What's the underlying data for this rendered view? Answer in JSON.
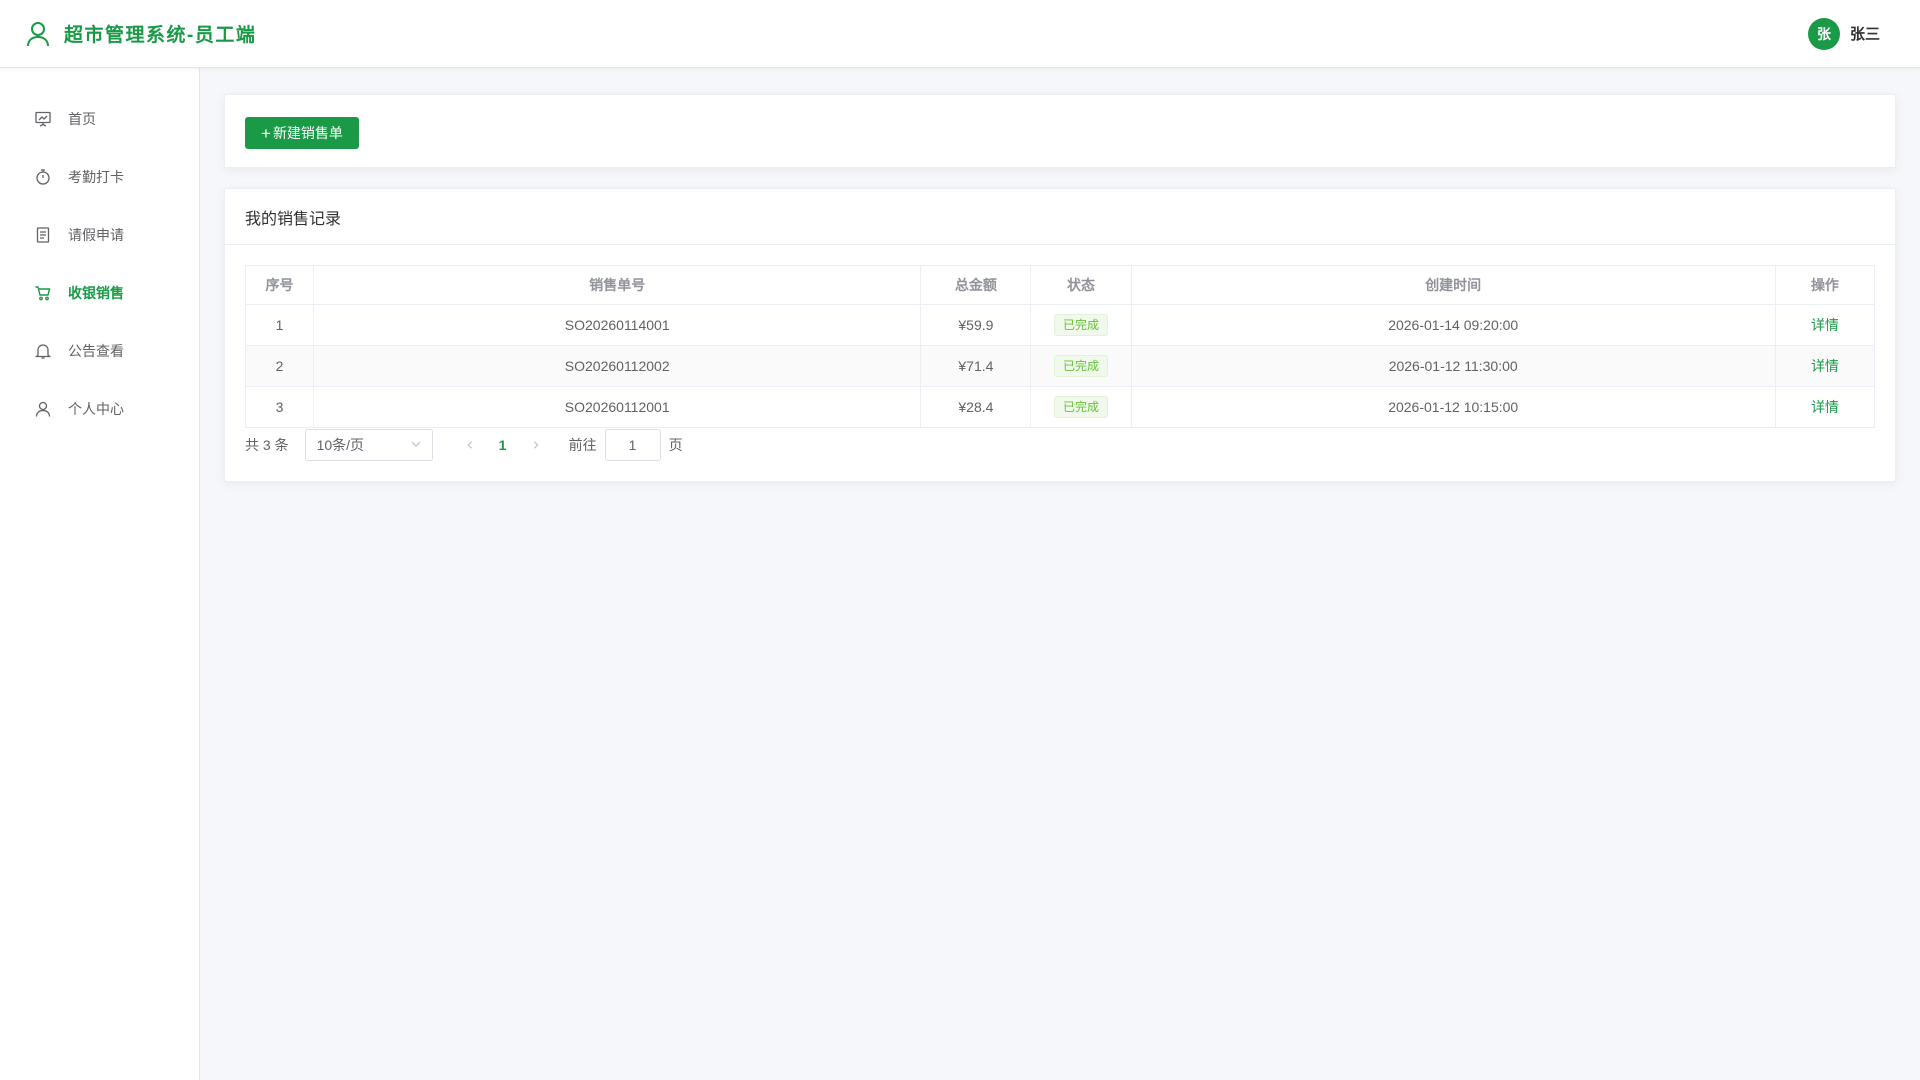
{
  "header": {
    "title": "超市管理系统-员工端",
    "avatar_text": "张",
    "username": "张三",
    "brand_icon": "user-outline-icon",
    "accent_color": "#1a9a46"
  },
  "sidebar": {
    "items": [
      {
        "label": "首页",
        "icon": "dashboard-board-icon",
        "active": false
      },
      {
        "label": "考勤打卡",
        "icon": "stopwatch-icon",
        "active": false
      },
      {
        "label": "请假申请",
        "icon": "document-icon",
        "active": false
      },
      {
        "label": "收银销售",
        "icon": "shopping-cart-icon",
        "active": true
      },
      {
        "label": "公告查看",
        "icon": "bell-icon",
        "active": false
      },
      {
        "label": "个人中心",
        "icon": "user-icon",
        "active": false
      }
    ]
  },
  "toolbar": {
    "new_sale_plus": "+",
    "new_sale_label": "新建销售单"
  },
  "records": {
    "title": "我的销售记录",
    "columns": [
      "序号",
      "销售单号",
      "总金额",
      "状态",
      "创建时间",
      "操作"
    ],
    "rows": [
      {
        "index": "1",
        "order_no": "SO20260114001",
        "amount": "¥59.9",
        "status": "已完成",
        "created": "2026-01-14 09:20:00",
        "action": "详情"
      },
      {
        "index": "2",
        "order_no": "SO20260112002",
        "amount": "¥71.4",
        "status": "已完成",
        "created": "2026-01-12 11:30:00",
        "action": "详情"
      },
      {
        "index": "3",
        "order_no": "SO20260112001",
        "amount": "¥28.4",
        "status": "已完成",
        "created": "2026-01-12 10:15:00",
        "action": "详情"
      }
    ]
  },
  "pagination": {
    "total": "共 3 条",
    "page_size": "10条/页",
    "prev_icon": "chevron-left-icon",
    "current_page": "1",
    "next_icon": "chevron-right-icon",
    "goto_label": "前往",
    "goto_value": "1",
    "page_suffix": "页"
  }
}
